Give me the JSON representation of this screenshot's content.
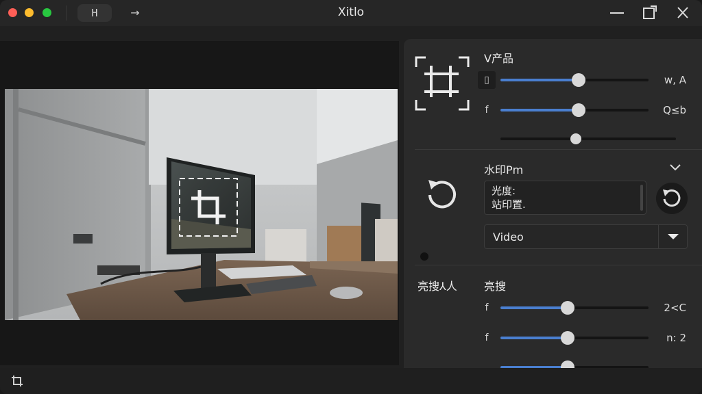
{
  "titlebar": {
    "tab_label": "H",
    "arrow_glyph": "→",
    "title": "Xitlo"
  },
  "panel": {
    "section1": {
      "title": "V产品",
      "rows": [
        {
          "icon": "▯",
          "value": "w, A",
          "level": 0.5
        },
        {
          "icon": "f",
          "value": "Q≤b",
          "level": 0.5
        },
        {
          "icon": "",
          "value": "",
          "level": 0.4
        }
      ]
    },
    "section2": {
      "title": "水印Pm",
      "text_lines": [
        "光度:",
        "站印置."
      ],
      "select_value": "Video"
    },
    "section3": {
      "label": "亮搜⅄人",
      "title": "亮搜",
      "rows": [
        {
          "icon": "f",
          "value": "2<C",
          "level": 0.45
        },
        {
          "icon": "f",
          "value": "n: 2",
          "level": 0.45
        },
        {
          "icon": "",
          "value": "",
          "level": 0.45
        }
      ]
    }
  },
  "colors": {
    "accent": "#4a7fd0",
    "panel_bg": "#2a2a2a",
    "window_bg": "#202020"
  },
  "icons": {
    "crop": "crop-icon",
    "rotate": "rotate-ccw-icon",
    "reset": "reset-icon",
    "chevron": "chevron-down-icon",
    "select_caret": "caret-down-icon",
    "bottom": "crop-small-icon"
  }
}
